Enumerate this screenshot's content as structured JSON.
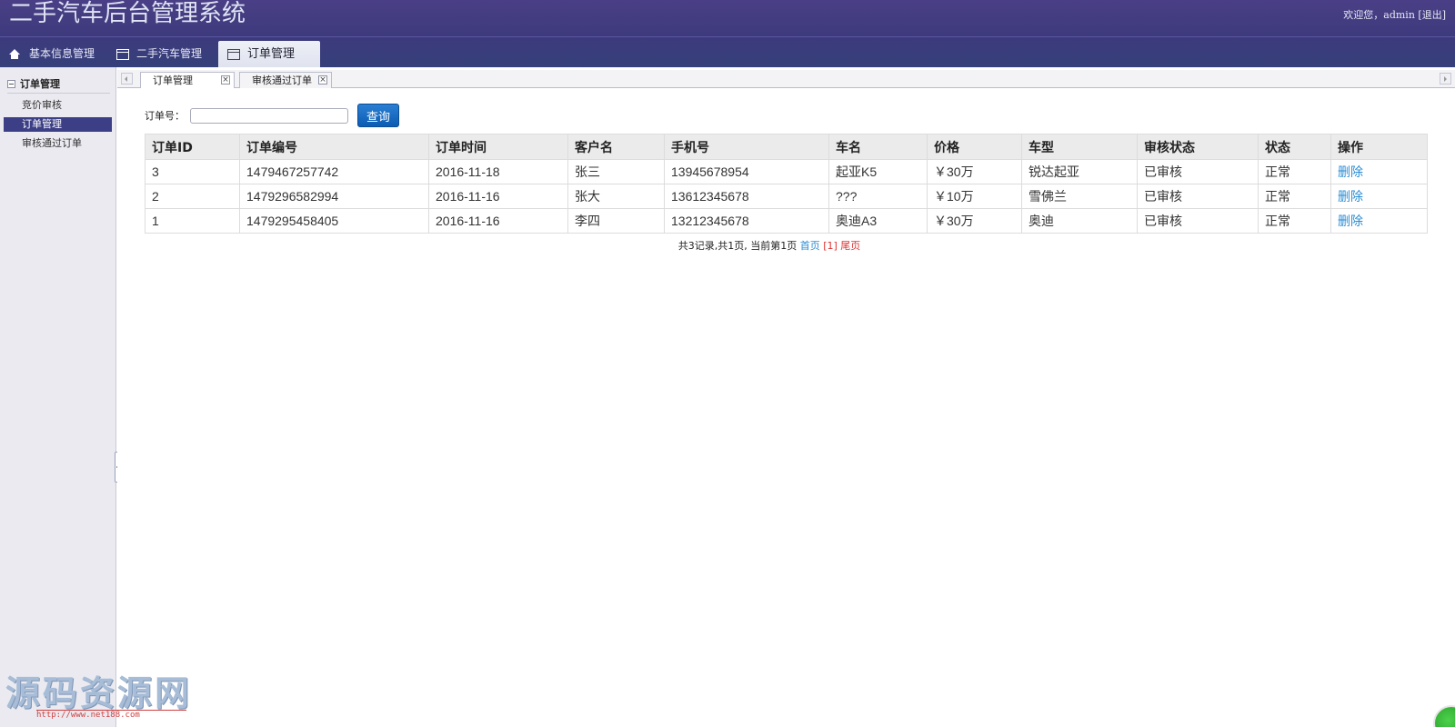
{
  "header": {
    "title": "二手汽车后台管理系统",
    "welcome": "欢迎您，admin",
    "logout": "[退出]"
  },
  "top_nav": {
    "items": [
      {
        "label": "基本信息管理",
        "icon": "home-icon"
      },
      {
        "label": "二手汽车管理",
        "icon": "window-icon"
      },
      {
        "label": "订单管理",
        "icon": "window-icon",
        "active": true
      }
    ]
  },
  "sidebar": {
    "heading": "订单管理",
    "items": [
      {
        "label": "竞价审核"
      },
      {
        "label": "订单管理",
        "active": true
      },
      {
        "label": "审核通过订单"
      }
    ]
  },
  "tab_strip": {
    "tabs": [
      {
        "label": "订单管理",
        "active": true,
        "close": "×"
      },
      {
        "label": "审核通过订单",
        "active": false,
        "close": "×"
      }
    ]
  },
  "search": {
    "label": "订单号：",
    "value": "",
    "button": "查询"
  },
  "table": {
    "headers": [
      "订单ID",
      "订单编号",
      "订单时间",
      "客户名",
      "手机号",
      "车名",
      "价格",
      "车型",
      "审核状态",
      "状态",
      "操作"
    ],
    "rows": [
      [
        "3",
        "1479467257742",
        "2016-11-18",
        "张三",
        "13945678954",
        "起亚K5",
        "￥30万",
        "锐达起亚",
        "已审核",
        "正常",
        "删除"
      ],
      [
        "2",
        "1479296582994",
        "2016-11-16",
        "张大",
        "13612345678",
        "???",
        "￥10万",
        "雪佛兰",
        "已审核",
        "正常",
        "删除"
      ],
      [
        "1",
        "1479295458405",
        "2016-11-16",
        "李四",
        "13212345678",
        "奥迪A3",
        "￥30万",
        "奥迪",
        "已审核",
        "正常",
        "删除"
      ]
    ]
  },
  "pager": {
    "summary": "共3记录,共1页, 当前第1页",
    "first": "首页",
    "current": "[1]",
    "last": "尾页"
  },
  "watermark": {
    "text": "源码资源网",
    "url": "http://www.net188.com"
  }
}
